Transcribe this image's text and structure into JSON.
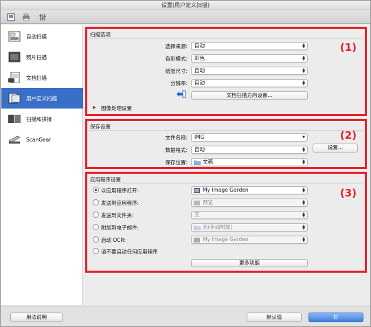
{
  "window": {
    "title": "设置(用户定义扫描)"
  },
  "toolbar": {
    "icons": [
      "scan-settings-icon",
      "printer-icon",
      "general-settings-icon"
    ]
  },
  "sidebar": {
    "items": [
      {
        "label": "自动扫描",
        "icon": "auto-scan-icon"
      },
      {
        "label": "照片扫描",
        "icon": "photo-scan-icon"
      },
      {
        "label": "文档扫描",
        "icon": "document-scan-icon"
      },
      {
        "label": "用户定义扫描",
        "icon": "custom-scan-icon",
        "active": true
      },
      {
        "label": "扫描和拼接",
        "icon": "scan-stitch-icon"
      },
      {
        "label": "ScanGear",
        "icon": "scangear-icon"
      }
    ]
  },
  "scan_options": {
    "heading": "扫描选项",
    "marker": "(1)",
    "fields": [
      {
        "label": "选择来源:",
        "value": "自动"
      },
      {
        "label": "色彩模式:",
        "value": "彩色"
      },
      {
        "label": "纸张尺寸:",
        "value": "自动"
      },
      {
        "label": "分辨率:",
        "value": "自动"
      }
    ],
    "orientation_button": "文档扫描方向设置...",
    "image_processing": "图像处理设置"
  },
  "save_settings": {
    "heading": "保存设置",
    "marker": "(2)",
    "filename_label": "文件名称:",
    "filename_value": "IMG",
    "format_label": "数据格式:",
    "format_value": "自动",
    "settings_button": "设置...",
    "location_label": "保存位置:",
    "location_value": "文稿"
  },
  "app_settings": {
    "heading": "应用程序设置",
    "marker": "(3)",
    "options": [
      {
        "label": "以应用程序打开:",
        "value": "My Image Garden",
        "selected": true,
        "disabled": false
      },
      {
        "label": "发送到应用程序:",
        "value": "预览",
        "selected": false,
        "disabled": true
      },
      {
        "label": "发送到文件夹:",
        "value": "无",
        "selected": false,
        "disabled": true
      },
      {
        "label": "附加到电子邮件:",
        "value": "无(手动附加)",
        "selected": false,
        "disabled": true
      },
      {
        "label": "启动 OCR:",
        "value": "My Image Garden",
        "selected": false,
        "disabled": true
      },
      {
        "label": "请不要启动任何应用程序",
        "value": "",
        "selected": false,
        "disabled": false
      }
    ],
    "more_button": "更多功能"
  },
  "bottom": {
    "help": "用法说明",
    "defaults": "默认值",
    "ok": "好"
  },
  "colors": {
    "accent": "#3a6fc8",
    "marker": "#e8202a"
  }
}
